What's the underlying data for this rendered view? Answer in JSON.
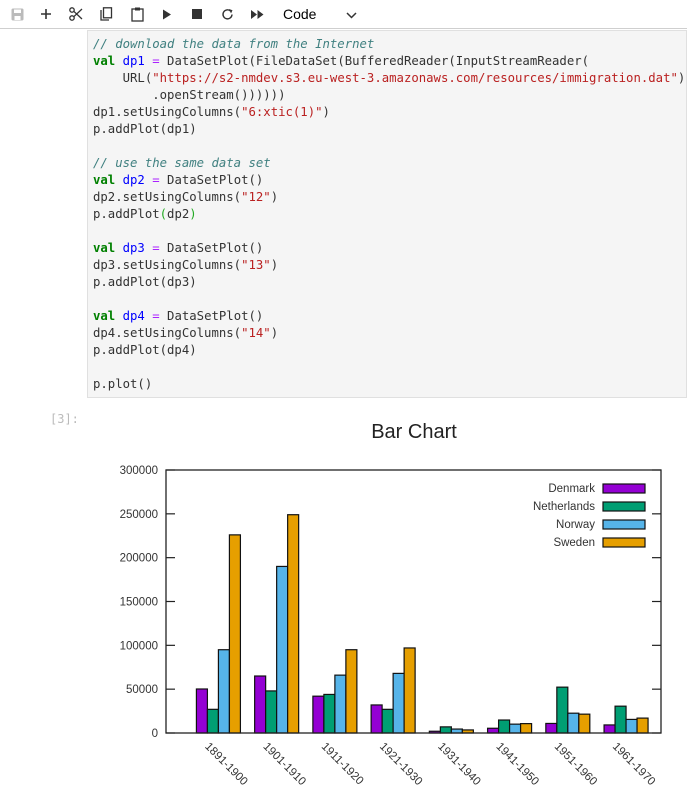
{
  "toolbar": {
    "buttons": [
      {
        "name": "save-button",
        "icon": "save-icon"
      },
      {
        "name": "insert-cell-button",
        "icon": "plus-icon"
      },
      {
        "name": "cut-button",
        "icon": "scissors-icon"
      },
      {
        "name": "copy-button",
        "icon": "copy-icon"
      },
      {
        "name": "paste-button",
        "icon": "clipboard-icon"
      },
      {
        "name": "run-button",
        "icon": "play-icon"
      },
      {
        "name": "stop-button",
        "icon": "stop-icon"
      },
      {
        "name": "restart-button",
        "icon": "restart-icon"
      },
      {
        "name": "run-all-button",
        "icon": "fast-forward-icon"
      }
    ],
    "cell_type": "Code"
  },
  "code": {
    "lines": [
      [
        {
          "t": "// download the data from the Internet",
          "c": "cm"
        }
      ],
      [
        {
          "t": "val",
          "c": "kw"
        },
        {
          "t": " "
        },
        {
          "t": "dp1",
          "c": "var"
        },
        {
          "t": " "
        },
        {
          "t": "=",
          "c": "op"
        },
        {
          "t": " DataSetPlot(FileDataSet(BufferedReader(InputStreamReader("
        }
      ],
      [
        {
          "t": "    URL("
        },
        {
          "t": "\"https://s2-nmdev.s3.eu-west-3.amazonaws.com/resources/immigration.dat\"",
          "c": "str"
        },
        {
          "t": ")"
        }
      ],
      [
        {
          "t": "        .openStream())))))"
        }
      ],
      [
        {
          "t": "dp1.setUsingColumns("
        },
        {
          "t": "\"6:xtic(1)\"",
          "c": "str"
        },
        {
          "t": ")"
        }
      ],
      [
        {
          "t": "p.addPlot(dp1)"
        }
      ],
      [],
      [
        {
          "t": "// use the same data set",
          "c": "cm"
        }
      ],
      [
        {
          "t": "val",
          "c": "kw"
        },
        {
          "t": " "
        },
        {
          "t": "dp2",
          "c": "var"
        },
        {
          "t": " "
        },
        {
          "t": "=",
          "c": "op"
        },
        {
          "t": " DataSetPlot()"
        }
      ],
      [
        {
          "t": "dp2.setUsingColumns("
        },
        {
          "t": "\"12\"",
          "c": "str"
        },
        {
          "t": ")"
        }
      ],
      [
        {
          "t": "p.addPlot"
        },
        {
          "t": "(",
          "c": "gp"
        },
        {
          "t": "dp2"
        },
        {
          "t": ")",
          "c": "gp"
        }
      ],
      [],
      [
        {
          "t": "val",
          "c": "kw"
        },
        {
          "t": " "
        },
        {
          "t": "dp3",
          "c": "var"
        },
        {
          "t": " "
        },
        {
          "t": "=",
          "c": "op"
        },
        {
          "t": " DataSetPlot()"
        }
      ],
      [
        {
          "t": "dp3.setUsingColumns("
        },
        {
          "t": "\"13\"",
          "c": "str"
        },
        {
          "t": ")"
        }
      ],
      [
        {
          "t": "p.addPlot(dp3)"
        }
      ],
      [],
      [
        {
          "t": "val",
          "c": "kw"
        },
        {
          "t": " "
        },
        {
          "t": "dp4",
          "c": "var"
        },
        {
          "t": " "
        },
        {
          "t": "=",
          "c": "op"
        },
        {
          "t": " DataSetPlot()"
        }
      ],
      [
        {
          "t": "dp4.setUsingColumns("
        },
        {
          "t": "\"14\"",
          "c": "str"
        },
        {
          "t": ")"
        }
      ],
      [
        {
          "t": "p.addPlot(dp4)"
        }
      ],
      [],
      [
        {
          "t": "p.plot()"
        }
      ]
    ]
  },
  "output": {
    "prompt": "[3]:"
  },
  "chart_data": {
    "type": "bar",
    "title": "Bar Chart",
    "xlabel": "",
    "ylabel": "",
    "ylim": [
      0,
      300000
    ],
    "yticks": [
      0,
      50000,
      100000,
      150000,
      200000,
      250000,
      300000
    ],
    "grid": false,
    "legend_position": "top-right",
    "categories": [
      "1891-1900",
      "1901-1910",
      "1911-1920",
      "1921-1930",
      "1931-1940",
      "1941-1950",
      "1951-1960",
      "1961-1970"
    ],
    "series": [
      {
        "name": "Denmark",
        "color": "#9400d3",
        "values": [
          50200,
          65000,
          42000,
          32000,
          2000,
          5400,
          10900,
          9200
        ]
      },
      {
        "name": "Netherlands",
        "color": "#009e73",
        "values": [
          27000,
          48000,
          44000,
          27000,
          7000,
          14800,
          52300,
          30600
        ]
      },
      {
        "name": "Norway",
        "color": "#56b4e9",
        "values": [
          95000,
          190000,
          66000,
          68000,
          4500,
          10100,
          22600,
          15500
        ]
      },
      {
        "name": "Sweden",
        "color": "#e69f00",
        "values": [
          226000,
          249000,
          95000,
          97000,
          3500,
          10700,
          21500,
          17000
        ]
      }
    ]
  }
}
